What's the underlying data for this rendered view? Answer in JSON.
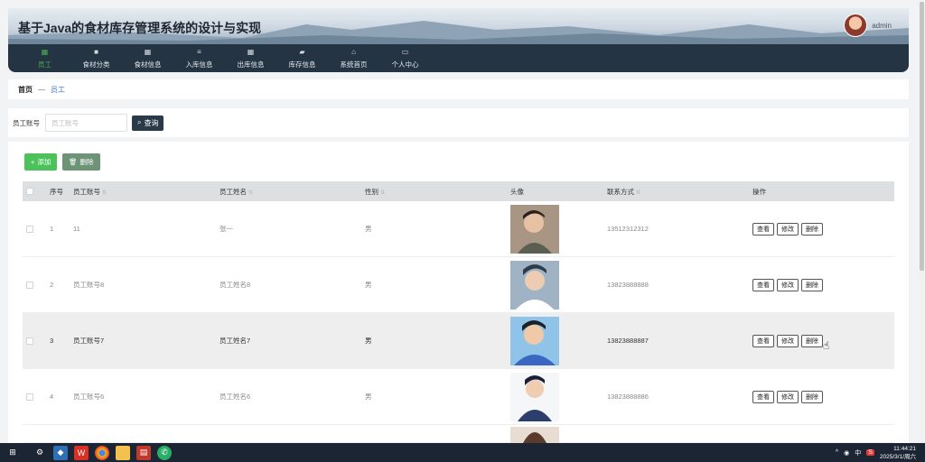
{
  "app": {
    "title": "基于Java的食材库存管理系统的设计与实现",
    "user": "admin"
  },
  "nav": [
    {
      "label": "员工",
      "icon": "grid-icon",
      "active": true
    },
    {
      "label": "食材分类",
      "icon": "square-icon",
      "active": false
    },
    {
      "label": "食材信息",
      "icon": "grid-icon",
      "active": false
    },
    {
      "label": "入库信息",
      "icon": "list-icon",
      "active": false
    },
    {
      "label": "出库信息",
      "icon": "grid-icon",
      "active": false
    },
    {
      "label": "库存信息",
      "icon": "chat-icon",
      "active": false
    },
    {
      "label": "系统首页",
      "icon": "home-icon",
      "active": false
    },
    {
      "label": "个人中心",
      "icon": "card-icon",
      "active": false
    }
  ],
  "breadcrumb": {
    "home": "首页",
    "sep": "—",
    "current": "员工"
  },
  "search": {
    "label": "员工账号",
    "placeholder": "员工账号",
    "value": "",
    "button": "查询"
  },
  "toolbar": {
    "add": "添加",
    "delete": "删除"
  },
  "table": {
    "headers": [
      "序号",
      "员工账号",
      "员工姓名",
      "性别",
      "头像",
      "联系方式",
      "操作"
    ],
    "rows": [
      {
        "no": "1",
        "account": "11",
        "name": "张一",
        "gender": "男",
        "phone": "13512312312"
      },
      {
        "no": "2",
        "account": "员工账号8",
        "name": "员工姓名8",
        "gender": "男",
        "phone": "13823888888"
      },
      {
        "no": "3",
        "account": "员工账号7",
        "name": "员工姓名7",
        "gender": "男",
        "phone": "13823888887"
      },
      {
        "no": "4",
        "account": "员工账号6",
        "name": "员工姓名6",
        "gender": "男",
        "phone": "13823888886"
      }
    ],
    "actions": {
      "view": "查看",
      "edit": "修改",
      "delete": "删除"
    }
  },
  "taskbar": {
    "time": "11:44:21",
    "date": "2025/3/1/周六",
    "ime": "中"
  },
  "colors": {
    "accent": "#4caf50",
    "header": "#243442",
    "add": "#4cc35a",
    "del": "#6e9477"
  }
}
